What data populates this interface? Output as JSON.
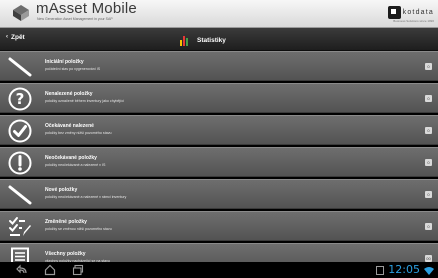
{
  "header": {
    "app_name": "mAsset Mobile",
    "subtitle": "New Generation Asset Management in your SAP",
    "brand": "kotdata",
    "brand_tagline": "Business Solutions since 1996"
  },
  "nav": {
    "back_label": "Zpět",
    "title": "Statistiky",
    "stats_icon_colors": [
      "#f5c200",
      "#e53935",
      "#43a047"
    ]
  },
  "menu": [
    {
      "title": "Iniciální položky",
      "description": "počáteční stav po vygenerování IS",
      "count": "0",
      "icon": "line-icon"
    },
    {
      "title": "Nenalezené položky",
      "description": "položky označené během inventury jako chybějící",
      "count": "0",
      "icon": "question-circle-icon"
    },
    {
      "title": "Očekávané nalezené",
      "description": "položky bez změny nižší pozorného stavu",
      "count": "0",
      "icon": "checkmark-circle-icon"
    },
    {
      "title": "Neočekávané položky",
      "description": "položky neočekávané a nalezené v IS",
      "count": "0",
      "icon": "exclamation-circle-icon"
    },
    {
      "title": "Nové položky",
      "description": "položky neočekávané a nalezené v rámci inventury",
      "count": "0",
      "icon": "line-icon"
    },
    {
      "title": "Změněné položky",
      "description": "položky se změnou nižší pozorného stavu",
      "count": "0",
      "icon": "checklist-edit-icon"
    },
    {
      "title": "Všechny položky",
      "description": "všechny položky nacházející se na stavu",
      "count": "00",
      "icon": "document-list-icon"
    }
  ],
  "system_bar": {
    "time": "12:05",
    "accent": "#2b9fe0"
  }
}
